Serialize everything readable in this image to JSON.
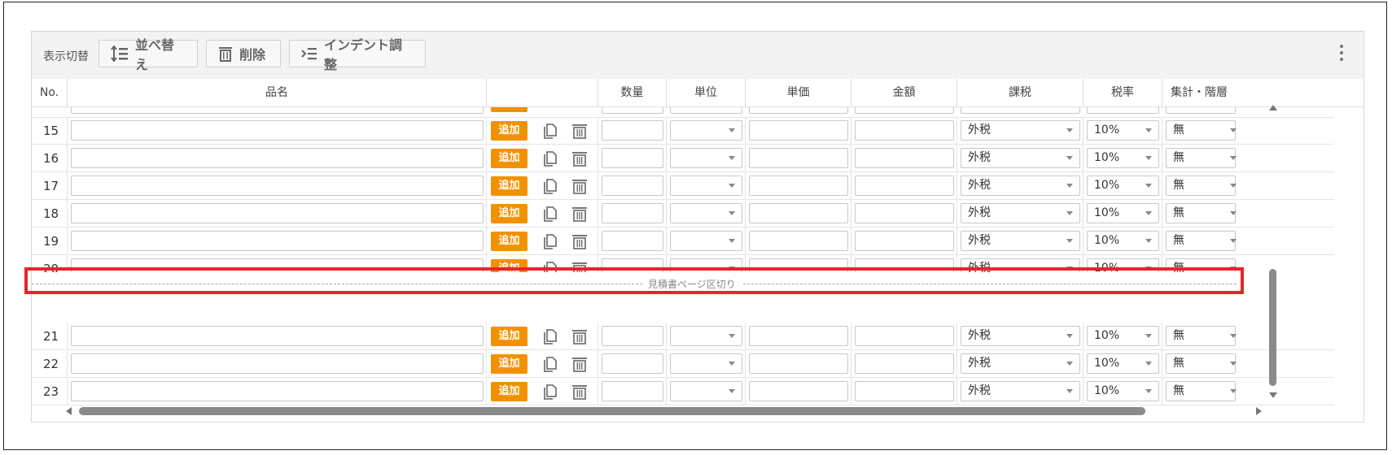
{
  "toolbar": {
    "display_toggle": "表示切替",
    "sort_label": "並べ替え",
    "delete_label": "削除",
    "indent_label": "インデント調整"
  },
  "columns": {
    "no": "No.",
    "name": "品名",
    "actions": "",
    "qty": "数量",
    "unit": "単位",
    "unit_price": "単価",
    "amount": "金額",
    "tax_type": "課税",
    "tax_rate": "税率",
    "aggregate": "集計・階層"
  },
  "row_labels": {
    "add": "追加",
    "tax_type": "外税",
    "tax_rate": "10%",
    "aggregate": "無"
  },
  "rows_before_break": [
    {
      "no": "15"
    },
    {
      "no": "16"
    },
    {
      "no": "17"
    },
    {
      "no": "18"
    },
    {
      "no": "19"
    },
    {
      "no": "20"
    }
  ],
  "page_break": {
    "label": "見積書ページ区切り"
  },
  "rows_after_break": [
    {
      "no": "21"
    },
    {
      "no": "22"
    },
    {
      "no": "23"
    }
  ],
  "colors": {
    "add_button": "#f29100",
    "highlight": "#e8242b",
    "header_text": "#444444"
  }
}
